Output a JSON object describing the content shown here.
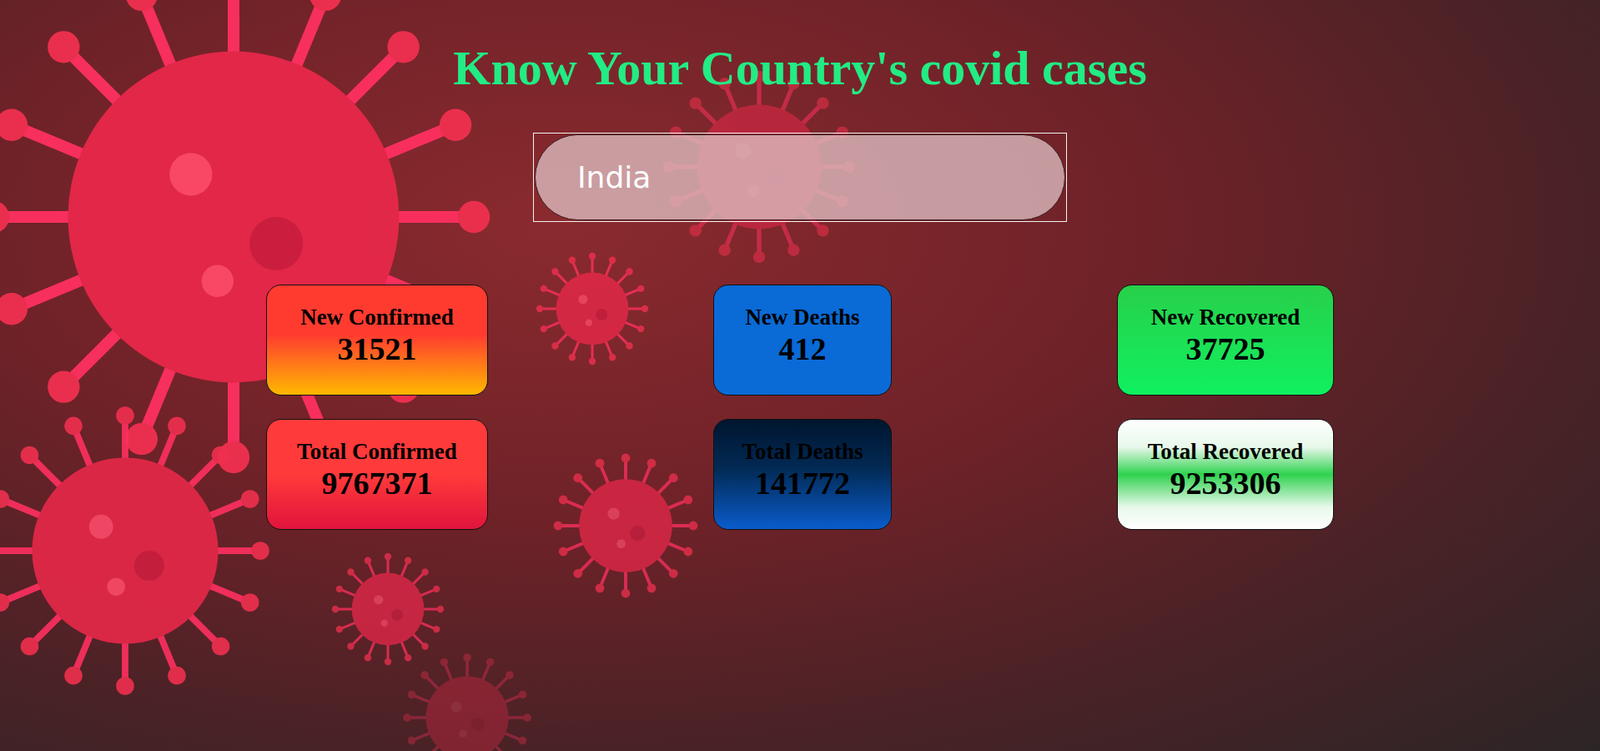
{
  "title": "Know Your Country's covid cases",
  "search": {
    "value": "India"
  },
  "cards": [
    {
      "label": "New Confirmed",
      "value": "31521",
      "color": "#ff3b30",
      "kind": "sunset"
    },
    {
      "label": "New Deaths",
      "value": "412",
      "color": "#0a6ad6",
      "kind": "flat"
    },
    {
      "label": "New Recovered",
      "value": "37725",
      "color": "#28d04a",
      "kind": "glow"
    },
    {
      "label": "Total Confirmed",
      "value": "9767371",
      "color": "#ff3a3a",
      "kind": "warm"
    },
    {
      "label": "Total Deaths",
      "value": "141772",
      "color": "#0a5ccc",
      "kind": "night"
    },
    {
      "label": "Total Recovered",
      "value": "9253306",
      "color": "#2fd24f",
      "kind": "shine"
    }
  ]
}
